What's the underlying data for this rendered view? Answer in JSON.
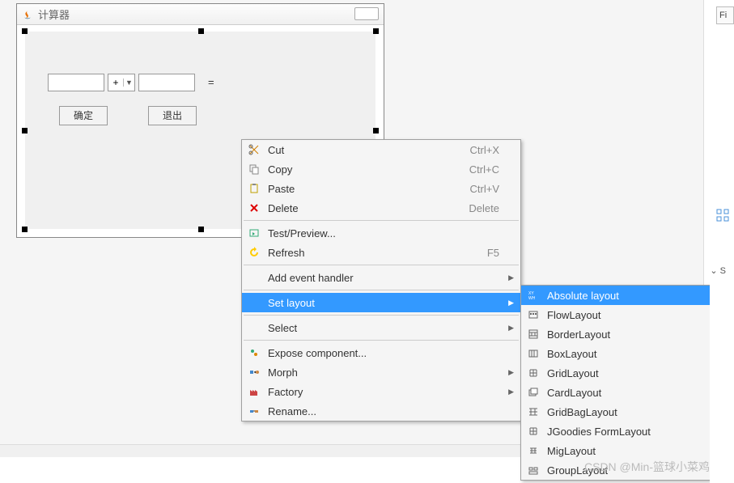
{
  "window": {
    "title": "计算器",
    "combo_value": "+",
    "equals": "=",
    "ok_button": "确定",
    "exit_button": "退出"
  },
  "menu": {
    "cut": {
      "label": "Cut",
      "shortcut": "Ctrl+X"
    },
    "copy": {
      "label": "Copy",
      "shortcut": "Ctrl+C"
    },
    "paste": {
      "label": "Paste",
      "shortcut": "Ctrl+V"
    },
    "delete": {
      "label": "Delete",
      "shortcut": "Delete"
    },
    "test": {
      "label": "Test/Preview..."
    },
    "refresh": {
      "label": "Refresh",
      "shortcut": "F5"
    },
    "add_event": {
      "label": "Add event handler"
    },
    "set_layout": {
      "label": "Set layout"
    },
    "select": {
      "label": "Select"
    },
    "expose": {
      "label": "Expose component..."
    },
    "morph": {
      "label": "Morph"
    },
    "factory": {
      "label": "Factory"
    },
    "rename": {
      "label": "Rename..."
    }
  },
  "submenu": {
    "absolute": "Absolute layout",
    "flow": "FlowLayout",
    "border": "BorderLayout",
    "box": "BoxLayout",
    "grid": "GridLayout",
    "card": "CardLayout",
    "gridbag": "GridBagLayout",
    "jgoodies": "JGoodies FormLayout",
    "mig": "MigLayout",
    "group": "GroupLayout"
  },
  "right": {
    "fir": "Fi",
    "s": "S"
  },
  "watermark": "CSDN @Min-篮球小菜鸡"
}
